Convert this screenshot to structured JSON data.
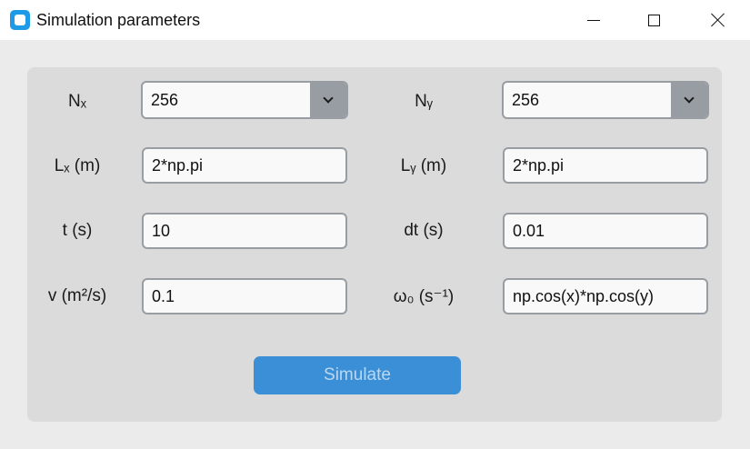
{
  "window": {
    "title": "Simulation parameters"
  },
  "labels": {
    "nx": "Nₓ",
    "ny": "Nᵧ",
    "lx": "Lₓ (m)",
    "ly": "Lᵧ (m)",
    "t": "t (s)",
    "dt": "dt (s)",
    "nu": "v (m²/s)",
    "omega0": "ω₀ (s⁻¹)"
  },
  "fields": {
    "nx": "256",
    "ny": "256",
    "lx": "2*np.pi",
    "ly": "2*np.pi",
    "t": "10",
    "dt": "0.01",
    "nu": "0.1",
    "omega0": "np.cos(x)*np.cos(y)"
  },
  "buttons": {
    "simulate": "Simulate"
  },
  "icons": {
    "app": "app-icon",
    "minimize": "minimize-icon",
    "maximize": "maximize-icon",
    "close": "close-icon",
    "dropdown": "chevron-down-icon"
  },
  "colors": {
    "accent": "#3a8fd6",
    "panel": "#dbdbdb",
    "border": "#979da2"
  }
}
